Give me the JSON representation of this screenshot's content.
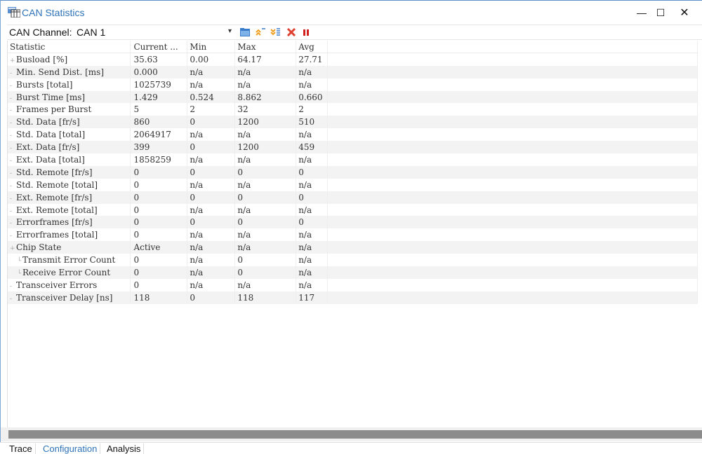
{
  "window": {
    "title": "CAN Statistics",
    "icon": "statistics-window-icon",
    "controls": {
      "minimize": "—",
      "maximize": "☐",
      "close": "✕"
    }
  },
  "toolbar": {
    "channel_label": "CAN Channel:",
    "channel_value": "CAN 1",
    "dropdown_glyph": "▾",
    "icons": [
      "open-folder-icon",
      "collapse-all-icon",
      "expand-all-icon",
      "reset-icon",
      "pause-icon"
    ]
  },
  "table": {
    "columns": [
      "Statistic",
      "Current ...",
      "Min",
      "Max",
      "Avg"
    ],
    "rows": [
      {
        "name": "Busload [%]",
        "current": "35.63",
        "min": "0.00",
        "max": "64.17",
        "avg": "27.71",
        "level": 0,
        "expandable": true
      },
      {
        "name": "Min. Send Dist. [ms]",
        "current": "0.000",
        "min": "n/a",
        "max": "n/a",
        "avg": "n/a",
        "level": 0
      },
      {
        "name": "Bursts [total]",
        "current": "1025739",
        "min": "n/a",
        "max": "n/a",
        "avg": "n/a",
        "level": 0
      },
      {
        "name": "Burst Time [ms]",
        "current": "1.429",
        "min": "0.524",
        "max": "8.862",
        "avg": "0.660",
        "level": 0
      },
      {
        "name": "Frames per Burst",
        "current": "5",
        "min": "2",
        "max": "32",
        "avg": "2",
        "level": 0
      },
      {
        "name": "Std. Data [fr/s]",
        "current": "860",
        "min": "0",
        "max": "1200",
        "avg": "510",
        "level": 0
      },
      {
        "name": "Std. Data [total]",
        "current": "2064917",
        "min": "n/a",
        "max": "n/a",
        "avg": "n/a",
        "level": 0
      },
      {
        "name": "Ext. Data [fr/s]",
        "current": "399",
        "min": "0",
        "max": "1200",
        "avg": "459",
        "level": 0
      },
      {
        "name": "Ext. Data [total]",
        "current": "1858259",
        "min": "n/a",
        "max": "n/a",
        "avg": "n/a",
        "level": 0
      },
      {
        "name": "Std. Remote [fr/s]",
        "current": "0",
        "min": "0",
        "max": "0",
        "avg": "0",
        "level": 0
      },
      {
        "name": "Std. Remote [total]",
        "current": "0",
        "min": "n/a",
        "max": "n/a",
        "avg": "n/a",
        "level": 0
      },
      {
        "name": "Ext. Remote [fr/s]",
        "current": "0",
        "min": "0",
        "max": "0",
        "avg": "0",
        "level": 0
      },
      {
        "name": "Ext. Remote [total]",
        "current": "0",
        "min": "n/a",
        "max": "n/a",
        "avg": "n/a",
        "level": 0
      },
      {
        "name": "Errorframes [fr/s]",
        "current": "0",
        "min": "0",
        "max": "0",
        "avg": "0",
        "level": 0
      },
      {
        "name": "Errorframes [total]",
        "current": "0",
        "min": "n/a",
        "max": "n/a",
        "avg": "n/a",
        "level": 0
      },
      {
        "name": "Chip State",
        "current": "Active",
        "min": "n/a",
        "max": "n/a",
        "avg": "n/a",
        "level": 0,
        "expandable": true
      },
      {
        "name": "Transmit Error Count",
        "current": "0",
        "min": "n/a",
        "max": "0",
        "avg": "n/a",
        "level": 1
      },
      {
        "name": "Receive Error Count",
        "current": "0",
        "min": "n/a",
        "max": "0",
        "avg": "n/a",
        "level": 1
      },
      {
        "name": "Transceiver Errors",
        "current": "0",
        "min": "n/a",
        "max": "n/a",
        "avg": "n/a",
        "level": 0
      },
      {
        "name": "Transceiver Delay [ns]",
        "current": "118",
        "min": "0",
        "max": "118",
        "avg": "117",
        "level": 0
      }
    ]
  },
  "tabs": [
    {
      "label": "Trace",
      "active": false
    },
    {
      "label": "Configuration",
      "active": true
    },
    {
      "label": "Analysis",
      "active": false
    }
  ],
  "colors": {
    "accent": "#2e73b8",
    "title_text": "#2e73b8",
    "scrollbar": "#8c8c8c",
    "alt_row": "#f3f3f3"
  }
}
